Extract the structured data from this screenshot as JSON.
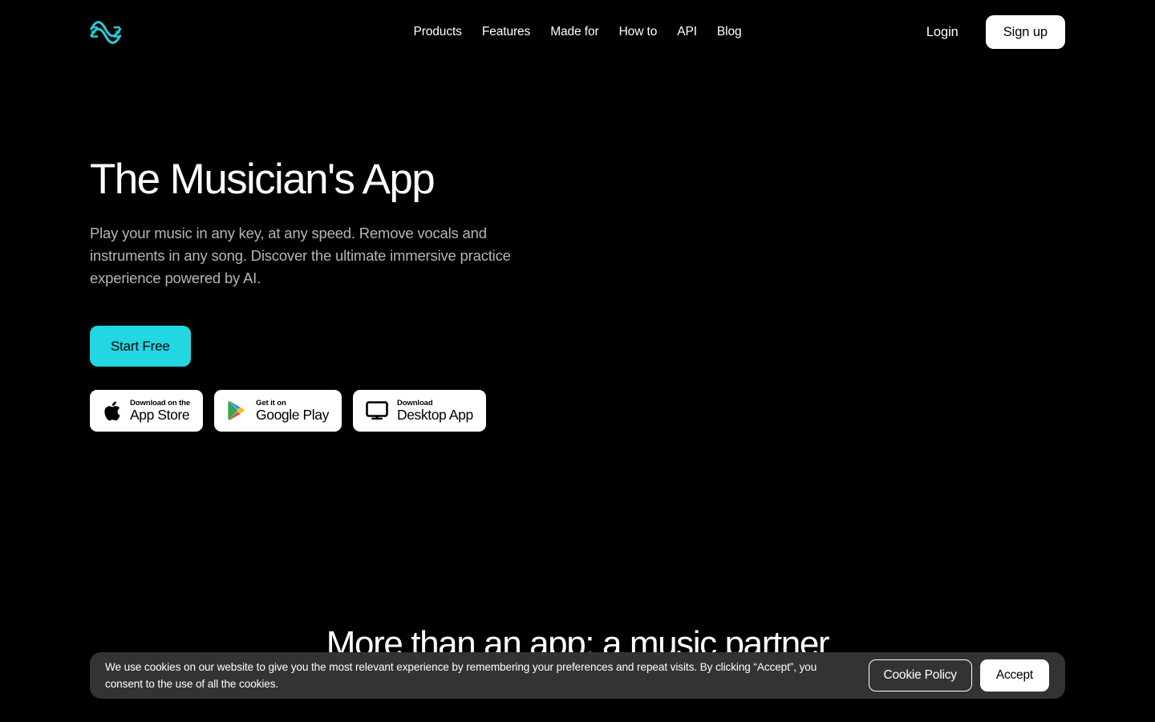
{
  "colors": {
    "background": "#000000",
    "accent": "#22d6e2",
    "text_primary": "#ffffff",
    "text_muted": "#b5b5b5",
    "cookie_bg": "#333333"
  },
  "header": {
    "logo_icon": "wave-logo-icon",
    "nav": [
      {
        "label": "Products"
      },
      {
        "label": "Features"
      },
      {
        "label": "Made for"
      },
      {
        "label": "How to"
      },
      {
        "label": "API"
      },
      {
        "label": "Blog"
      }
    ],
    "login_label": "Login",
    "signup_label": "Sign up"
  },
  "hero": {
    "title": "The Musician's App",
    "subtitle": "Play your music in any key, at any speed. Remove vocals and instruments in any song. Discover the ultimate immersive practice experience powered by AI.",
    "cta_label": "Start Free",
    "store_badges": [
      {
        "icon": "apple-icon",
        "small_label": "Download on the",
        "large_label": "App Store"
      },
      {
        "icon": "google-play-icon",
        "small_label": "Get it on",
        "large_label": "Google Play"
      },
      {
        "icon": "desktop-monitor-icon",
        "small_label": "Download",
        "large_label": "Desktop App"
      }
    ]
  },
  "section": {
    "heading": "More than an app: a music partner",
    "subheading": ""
  },
  "cookie_banner": {
    "message": "We use cookies on our website to give you the most relevant experience by remembering your preferences and repeat visits. By clicking “Accept”, you consent to the use of all the cookies.",
    "policy_label": "Cookie Policy",
    "accept_label": "Accept"
  }
}
